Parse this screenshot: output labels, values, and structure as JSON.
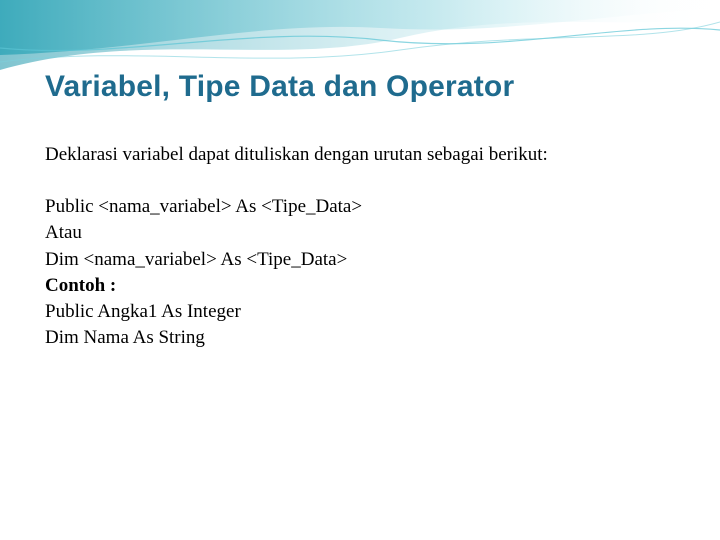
{
  "title": "Variabel, Tipe Data dan Operator",
  "intro": "Deklarasi variabel dapat dituliskan dengan urutan sebagai berikut:",
  "lines": {
    "l1": "Public <nama_variabel> As <Tipe_Data>",
    "l2": "Atau",
    "l3": "Dim <nama_variabel> As <Tipe_Data>",
    "l4": "Contoh :",
    "l5": "Public Angka1 As Integer",
    "l6": "Dim Nama As String"
  }
}
